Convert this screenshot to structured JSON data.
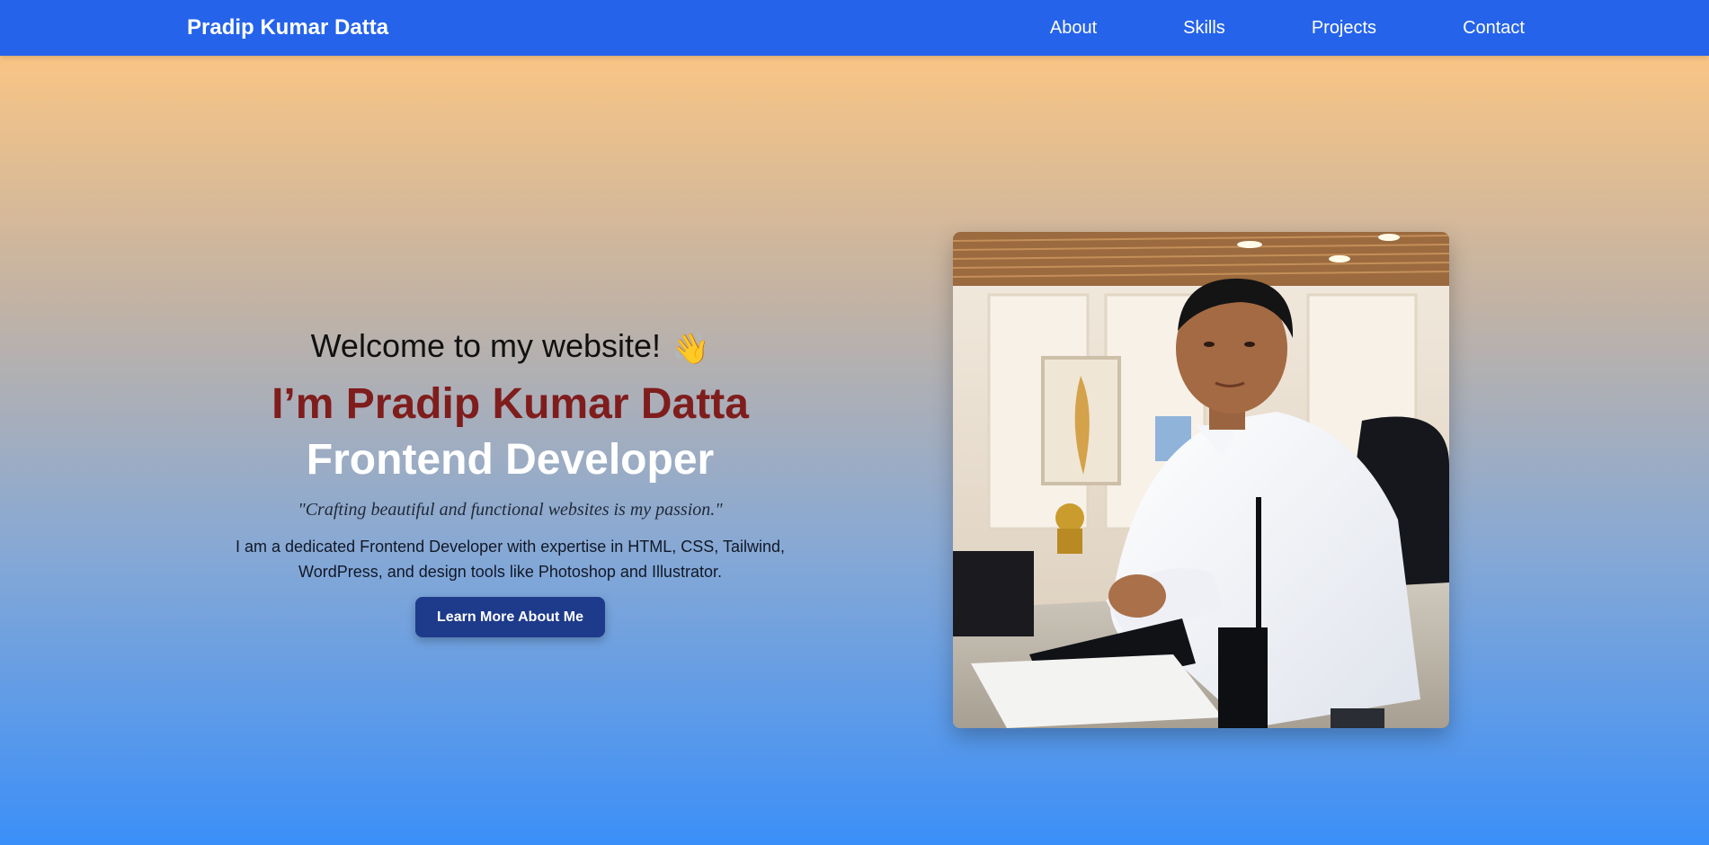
{
  "navbar": {
    "brand": "Pradip Kumar Datta",
    "links": [
      {
        "label": "About"
      },
      {
        "label": "Skills"
      },
      {
        "label": "Projects"
      },
      {
        "label": "Contact"
      }
    ]
  },
  "hero": {
    "welcome": "Welcome to my website!",
    "wave_emoji": "👋",
    "name_heading": "I’m Pradip Kumar Datta",
    "role_heading": "Frontend Developer",
    "tagline": "\"Crafting beautiful and functional websites is my passion.\"",
    "intro": "I am a dedicated Frontend Developer with expertise in HTML, CSS, Tailwind, WordPress, and design tools like Photoshop and Illustrator.",
    "cta_label": "Learn More About Me",
    "photo_icon": "profile-photo"
  },
  "colors": {
    "navbar": "#2563eb",
    "name_heading": "#7f1d1d",
    "cta_bg": "#1e3a8a"
  }
}
